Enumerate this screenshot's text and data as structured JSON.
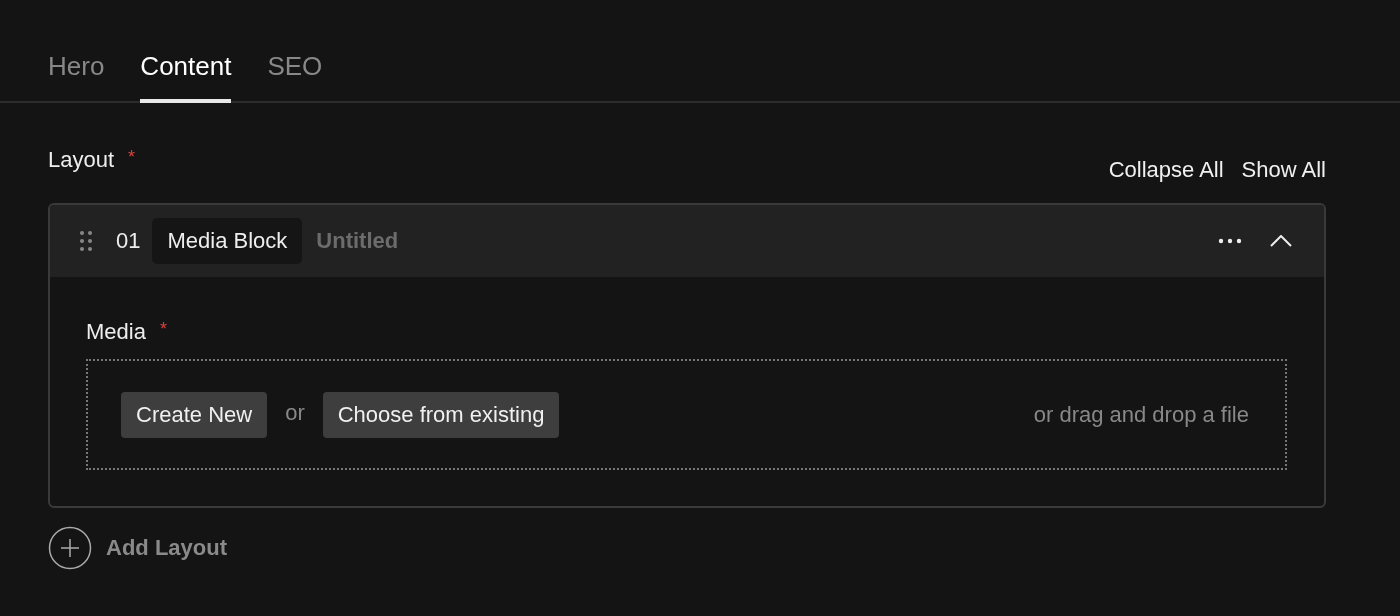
{
  "tabs": [
    {
      "label": "Hero",
      "selected": false
    },
    {
      "label": "Content",
      "selected": true
    },
    {
      "label": "SEO",
      "selected": false
    }
  ],
  "layout_field": {
    "label": "Layout",
    "required_mark": "*",
    "actions": [
      "Collapse All",
      "Show All"
    ],
    "blocks": [
      {
        "number": "01",
        "type": "Media Block",
        "title": "Untitled",
        "expanded": true,
        "fields": [
          {
            "label": "Media",
            "required_mark": "*",
            "buttons": [
              "Create New",
              "Choose from existing"
            ],
            "separator": "or",
            "drop_hint": "or drag and drop a file"
          }
        ]
      }
    ],
    "add_button": "Add Layout"
  }
}
